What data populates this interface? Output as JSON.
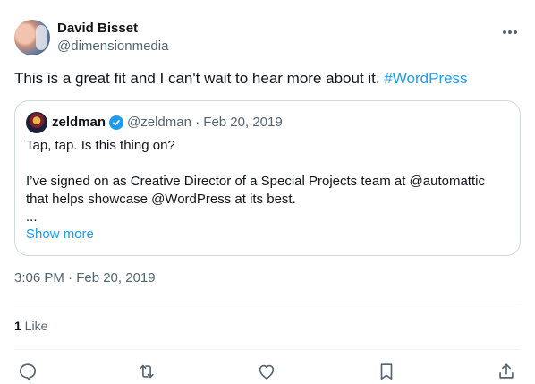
{
  "author": {
    "name": "David Bisset",
    "handle": "@dimensionmedia"
  },
  "tweet": {
    "text": "This is a great fit and I can't wait to hear more about it. ",
    "hashtag": "#WordPress",
    "timestamp": "3:06 PM · Feb 20, 2019"
  },
  "quoted": {
    "name": "zeldman",
    "handle": "@zeldman",
    "date": "Feb 20, 2019",
    "meta_separator": " · ",
    "line1": "Tap, tap. Is this thing on?",
    "line2": "I’ve signed on as Creative Director of a Special Projects team at @automattic",
    "line3": "that helps showcase @WordPress at its best.",
    "ellipsis": "...",
    "show_more": "Show more"
  },
  "engagement": {
    "like_count": "1",
    "like_label": " Like"
  },
  "icons": {
    "more": "more-dots-icon",
    "verified": "verified-badge-icon",
    "reply": "reply-icon",
    "retweet": "retweet-icon",
    "like": "heart-icon",
    "bookmark": "bookmark-icon",
    "share": "share-icon"
  },
  "colors": {
    "accent": "#1d9bf0",
    "secondary_text": "#536471",
    "primary_text": "#0f1419",
    "border": "#cfd9de"
  }
}
